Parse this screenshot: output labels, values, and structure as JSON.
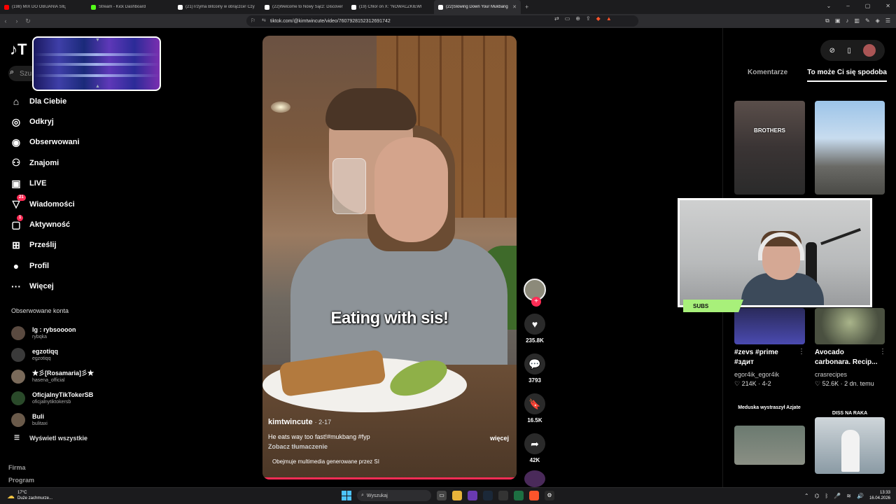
{
  "browser": {
    "tabs": [
      {
        "label": "(198) MIX DO OBIJANIA SIĘ",
        "icon": "youtube-icon",
        "color": "#ff0000"
      },
      {
        "label": "Stream - Kick Dashboard",
        "icon": "kick-icon",
        "color": "#53fc18"
      },
      {
        "label": "(21)Trzyma Bitcoiny w obrączce! Czy",
        "icon": "tiktok-icon",
        "color": "#ffffff"
      },
      {
        "label": "(22)Welcome to Nowy Sącz: Discover",
        "icon": "tiktok-icon",
        "color": "#ffffff"
      },
      {
        "label": "(19) Chlor on X: \"NOWACZKIEWI",
        "icon": "x-icon",
        "color": "#ffffff"
      },
      {
        "label": "(22)Slowing Down Your Mukbang",
        "icon": "tiktok-icon",
        "color": "#ffffff",
        "active": true
      }
    ],
    "url": "tiktok.com/@kimtwincute/video/7607928152312691742"
  },
  "sidebar": {
    "search_placeholder": "Szu",
    "nav": [
      {
        "label": "Dla Ciebie",
        "icon": "home-icon"
      },
      {
        "label": "Odkryj",
        "icon": "compass-icon"
      },
      {
        "label": "Obserwowani",
        "icon": "following-avatar-icon"
      },
      {
        "label": "Znajomi",
        "icon": "friends-icon"
      },
      {
        "label": "LIVE",
        "icon": "live-icon"
      },
      {
        "label": "Wiadomości",
        "icon": "messages-icon",
        "badge": "21"
      },
      {
        "label": "Aktywność",
        "icon": "activity-icon",
        "badge": "1"
      },
      {
        "label": "Prześlij",
        "icon": "upload-icon"
      },
      {
        "label": "Profil",
        "icon": "profile-icon"
      },
      {
        "label": "Więcej",
        "icon": "more-icon"
      }
    ],
    "followed_heading": "Obserwowane konta",
    "followed": [
      {
        "name": "lg : rybsoooon",
        "handle": "rybqka"
      },
      {
        "name": "egzotiqq",
        "handle": "egzotiqq"
      },
      {
        "name": "★彡[Rosamaria]彡★",
        "handle": "hasena_official"
      },
      {
        "name": "OficjalnyTikTokerSB",
        "handle": "oficjalnytiktokersb"
      },
      {
        "name": "Buli",
        "handle": "bulitaxi"
      }
    ],
    "see_all": "Wyświetl wszystkie",
    "footer": [
      "Firma",
      "Program"
    ]
  },
  "video": {
    "overlay_caption": "Eating with sis!",
    "author": "kimtwincute",
    "date": "· 2-17",
    "description": "He eats way too fast!#mukbang #fyp",
    "more": "więcej",
    "translate": "Zobacz tłumaczenie",
    "ai_notice": "Obejmuje multimedia generowane przez SI",
    "likes": "235.8K",
    "comments": "3793",
    "saves": "16.5K",
    "shares": "42K"
  },
  "rightpanel": {
    "tabs": [
      "Komentarze",
      "To może Ci się spodoba"
    ],
    "thumb1_label": "BROTHERS",
    "item3": {
      "caption": "#zevs #prime #здит",
      "user": "egor4ik_egor4ik",
      "stats": "♡ 214K · 4-2"
    },
    "item4": {
      "caption": "Avocado carbonara. Recip...",
      "user": "crasrecipes",
      "stats": "♡ 52.6K · 2 dn. temu"
    },
    "thumb5_label": "Meduska wystraszył Azjate",
    "thumb6_label": "DISS NA RAKA"
  },
  "webcam": {
    "subs_label": "SUBS"
  },
  "taskbar": {
    "temp": "17°C",
    "weather": "Duże zachmurze...",
    "search": "Wyszukaj",
    "time": "13:33",
    "date": "16.04.2026"
  }
}
